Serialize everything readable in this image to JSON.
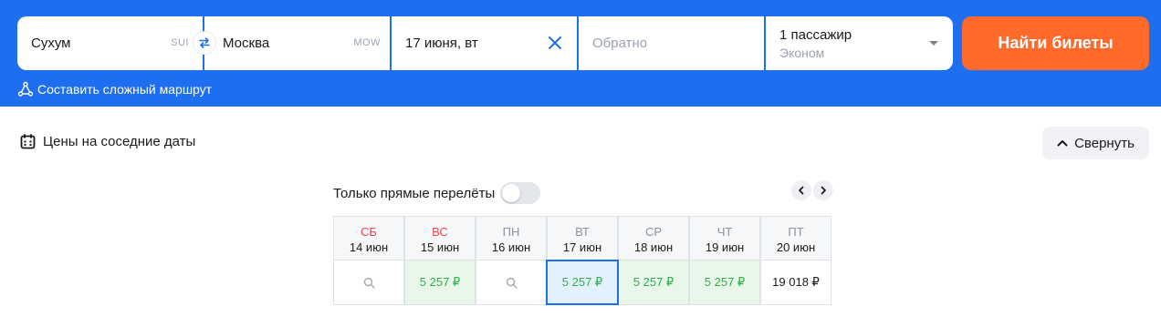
{
  "search": {
    "origin_city": "Сухум",
    "origin_code": "SUI",
    "destination_city": "Москва",
    "destination_code": "MOW",
    "depart_date": "17 июня, вт",
    "return_placeholder": "Обратно",
    "passengers": "1 пассажир",
    "cabin_class": "Эконом",
    "search_button": "Найти билеты",
    "complex_route": "Составить сложный маршрут"
  },
  "nearby": {
    "title": "Цены на соседние даты",
    "collapse": "Свернуть",
    "direct_only": "Только прямые перелёты",
    "direct_only_on": false,
    "days": [
      {
        "dow": "СБ",
        "date": "14 июн",
        "weekend": true,
        "price": null
      },
      {
        "dow": "ВС",
        "date": "15 июн",
        "weekend": true,
        "price": "5 257 ₽"
      },
      {
        "dow": "ПН",
        "date": "16 июн",
        "weekend": false,
        "price": null
      },
      {
        "dow": "ВТ",
        "date": "17 июн",
        "weekend": false,
        "price": "5 257 ₽"
      },
      {
        "dow": "СР",
        "date": "18 июн",
        "weekend": false,
        "price": "5 257 ₽"
      },
      {
        "dow": "ЧТ",
        "date": "19 июн",
        "weekend": false,
        "price": "5 257 ₽"
      },
      {
        "dow": "ПТ",
        "date": "20 июн",
        "weekend": false,
        "price": "19 018 ₽"
      }
    ]
  },
  "colors": {
    "brand_blue": "#1e6ff0",
    "cta_orange": "#ff6a2b",
    "price_green": "#2fae4b",
    "weekend_red": "#f0444c"
  },
  "icons": [
    "swap-icon",
    "clear-icon",
    "route-icon",
    "calendar-icon",
    "chevron-up-icon",
    "chevron-left-icon",
    "chevron-right-icon",
    "search-icon"
  ]
}
